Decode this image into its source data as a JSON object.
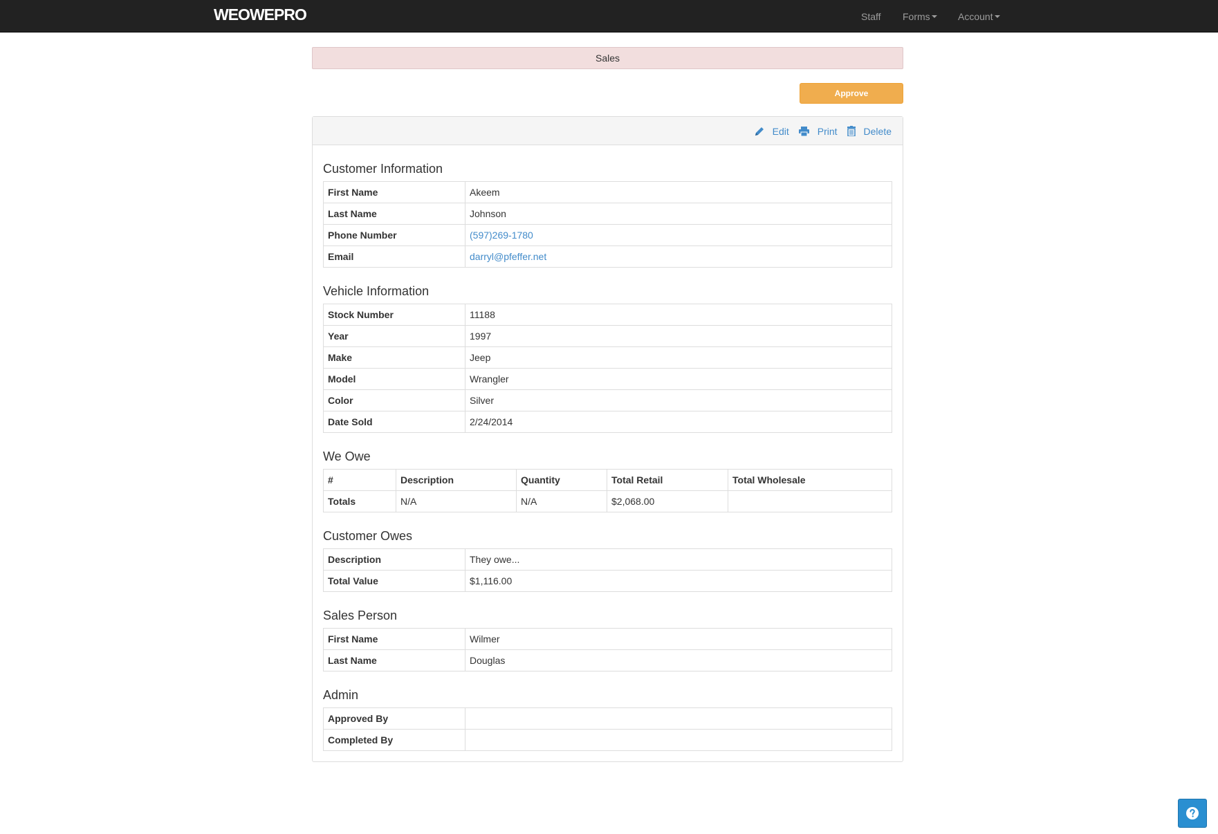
{
  "navbar": {
    "brand": "WEOWEPRO",
    "staff": "Staff",
    "forms": "Forms",
    "account": "Account"
  },
  "alert": "Sales",
  "approve_label": "Approve",
  "actions": {
    "edit": "Edit",
    "print": "Print",
    "delete": "Delete"
  },
  "customer": {
    "title": "Customer Information",
    "rows": [
      {
        "label": "First Name",
        "value": "Akeem"
      },
      {
        "label": "Last Name",
        "value": "Johnson"
      },
      {
        "label": "Phone Number",
        "value": "(597)269-1780"
      },
      {
        "label": "Email",
        "value": "darryl@pfeffer.net"
      }
    ]
  },
  "vehicle": {
    "title": "Vehicle Information",
    "rows": [
      {
        "label": "Stock Number",
        "value": "11188"
      },
      {
        "label": "Year",
        "value": "1997"
      },
      {
        "label": "Make",
        "value": "Jeep"
      },
      {
        "label": "Model",
        "value": "Wrangler"
      },
      {
        "label": "Color",
        "value": "Silver"
      },
      {
        "label": "Date Sold",
        "value": "2/24/2014"
      }
    ]
  },
  "we_owe": {
    "title": "We Owe",
    "headers": [
      "#",
      "Description",
      "Quantity",
      "Total Retail",
      "Total Wholesale"
    ],
    "totals": [
      "Totals",
      "N/A",
      "N/A",
      "$2,068.00",
      ""
    ]
  },
  "customer_owes": {
    "title": "Customer Owes",
    "rows": [
      {
        "label": "Description",
        "value": "They owe..."
      },
      {
        "label": "Total Value",
        "value": "$1,116.00"
      }
    ]
  },
  "sales_person": {
    "title": "Sales Person",
    "rows": [
      {
        "label": "First Name",
        "value": "Wilmer"
      },
      {
        "label": "Last Name",
        "value": "Douglas"
      }
    ]
  },
  "admin": {
    "title": "Admin",
    "rows": [
      {
        "label": "Approved By",
        "value": ""
      },
      {
        "label": "Completed By",
        "value": ""
      }
    ]
  },
  "colors": {
    "navbar": "#222222",
    "alert_bg": "#f2dede",
    "approve": "#f0ad4e",
    "link": "#428bca",
    "help": "#2a8fd1"
  }
}
